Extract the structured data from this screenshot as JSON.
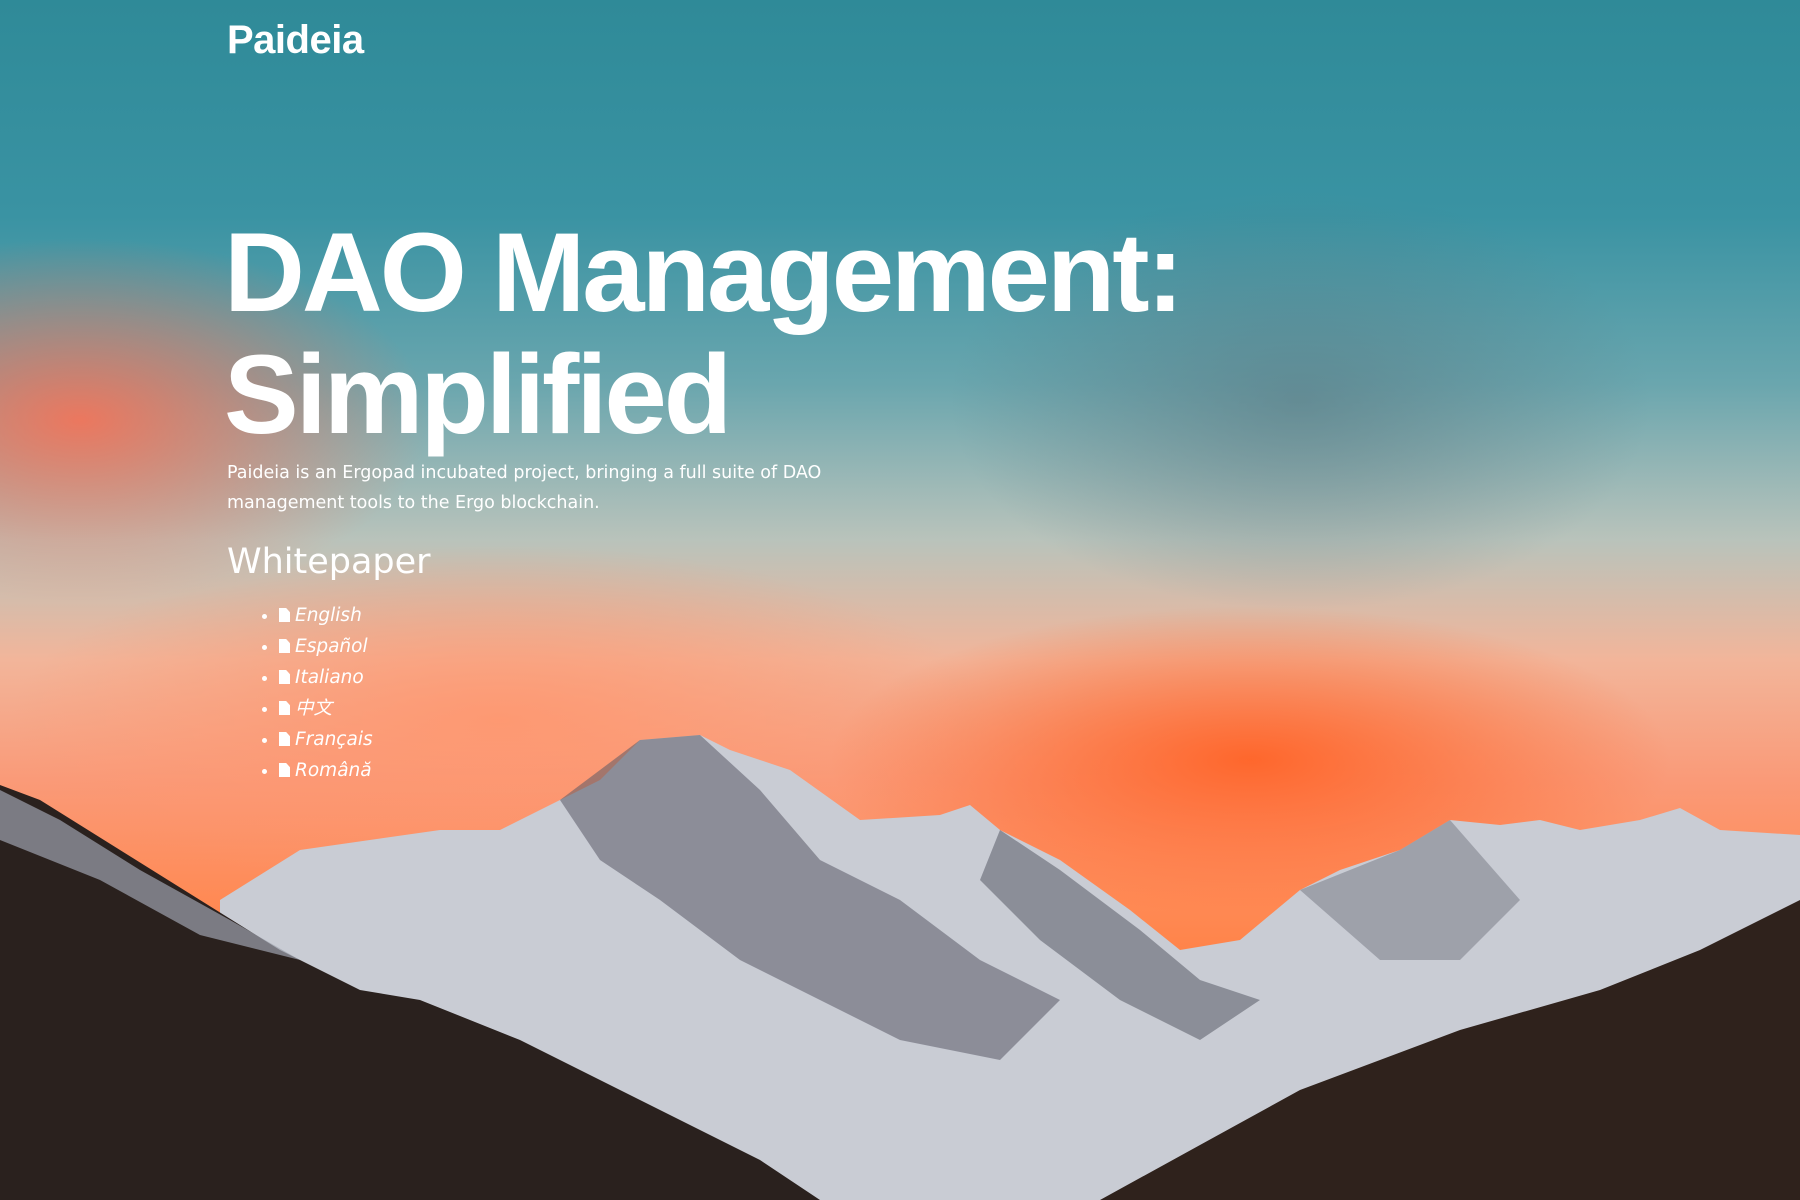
{
  "header": {
    "logo": "Paideia"
  },
  "hero": {
    "title_line1": "DAO Management:",
    "title_line2": "Simplified",
    "description": "Paideia is an Ergopad incubated project, bringing a full suite of DAO management tools to the Ergo blockchain."
  },
  "whitepaper": {
    "heading": "Whitepaper",
    "icon": "file-download-icon",
    "items": [
      {
        "label": "English"
      },
      {
        "label": "Español"
      },
      {
        "label": "Italiano"
      },
      {
        "label": "中文"
      },
      {
        "label": "Français"
      },
      {
        "label": "Română"
      }
    ]
  }
}
